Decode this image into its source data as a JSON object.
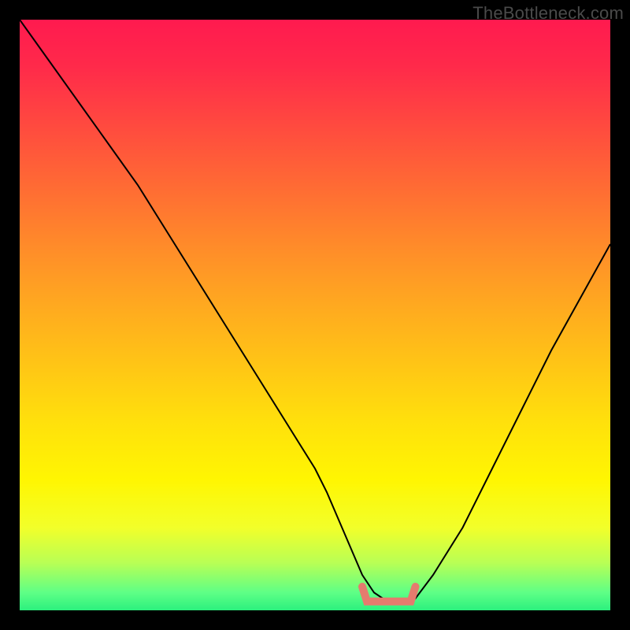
{
  "watermark": "TheBottleneck.com",
  "chart_data": {
    "type": "line",
    "title": "",
    "xlabel": "",
    "ylabel": "",
    "xlim": [
      0,
      100
    ],
    "ylim": [
      0,
      100
    ],
    "grid": false,
    "series": [
      {
        "name": "bottleneck-curve",
        "x": [
          0,
          5,
          10,
          15,
          20,
          25,
          30,
          35,
          40,
          45,
          50,
          52,
          55,
          58,
          60,
          63,
          66,
          67,
          70,
          75,
          80,
          85,
          90,
          95,
          100
        ],
        "values": [
          100,
          93,
          86,
          79,
          72,
          64,
          56,
          48,
          40,
          32,
          24,
          20,
          13,
          6,
          3,
          1,
          1,
          2,
          6,
          14,
          24,
          34,
          44,
          53,
          62
        ]
      }
    ],
    "highlight": {
      "name": "optimal-trough",
      "x_start": 58,
      "x_end": 67,
      "y_level": 1.5
    },
    "gradient_stops": [
      {
        "pos": 0.0,
        "color": "#ff1a4f"
      },
      {
        "pos": 0.5,
        "color": "#ffb818"
      },
      {
        "pos": 0.8,
        "color": "#fff602"
      },
      {
        "pos": 1.0,
        "color": "#2cf07e"
      }
    ]
  }
}
